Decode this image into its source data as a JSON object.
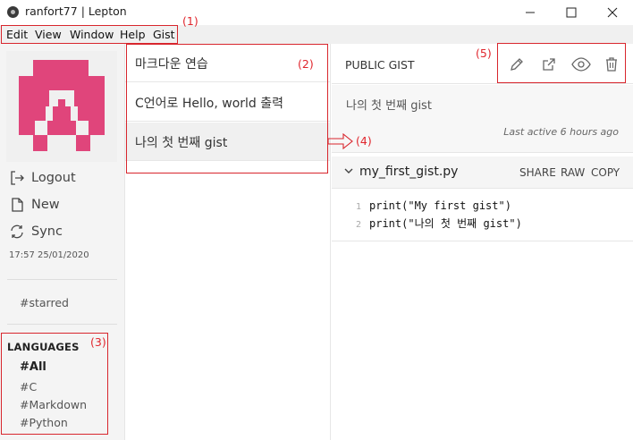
{
  "window": {
    "title": "ranfort77 | Lepton"
  },
  "menu": {
    "items": [
      "Edit",
      "View",
      "Window",
      "Help",
      "Gist"
    ]
  },
  "annotations": {
    "a1": "(1)",
    "a2": "(2)",
    "a3": "(3)",
    "a4": "(4)",
    "a5": "(5)"
  },
  "sidebar": {
    "logout": "Logout",
    "new": "New",
    "sync": "Sync",
    "sync_time": "17:57 25/01/2020",
    "starred": "#starred",
    "languages_heading": "LANGUAGES",
    "languages": [
      "#All",
      "#C",
      "#Markdown",
      "#Python"
    ]
  },
  "gists": [
    {
      "title": "마크다운 연습"
    },
    {
      "title": "C언어로 Hello, world 출력"
    },
    {
      "title": "나의 첫 번째 gist",
      "selected": true
    }
  ],
  "detail": {
    "visibility": "PUBLIC GIST",
    "description": "나의 첫 번째 gist",
    "last_active": "Last active 6 hours ago",
    "file": {
      "name": "my_first_gist.py",
      "actions": [
        "SHARE",
        "RAW",
        "COPY"
      ],
      "lines": [
        {
          "no": "1",
          "code": "print(\"My first gist\")"
        },
        {
          "no": "2",
          "code": "print(\"나의 첫 번째 gist\")"
        }
      ]
    }
  },
  "colors": {
    "accent_red": "#d8262d",
    "avatar_pink": "#e0457b"
  },
  "icons": [
    "app-icon",
    "minimize-icon",
    "maximize-icon",
    "close-icon",
    "logout-icon",
    "new-file-icon",
    "sync-icon",
    "pencil-icon",
    "external-link-icon",
    "eye-icon",
    "trash-icon",
    "chevron-down-icon",
    "arrow-right-icon"
  ]
}
